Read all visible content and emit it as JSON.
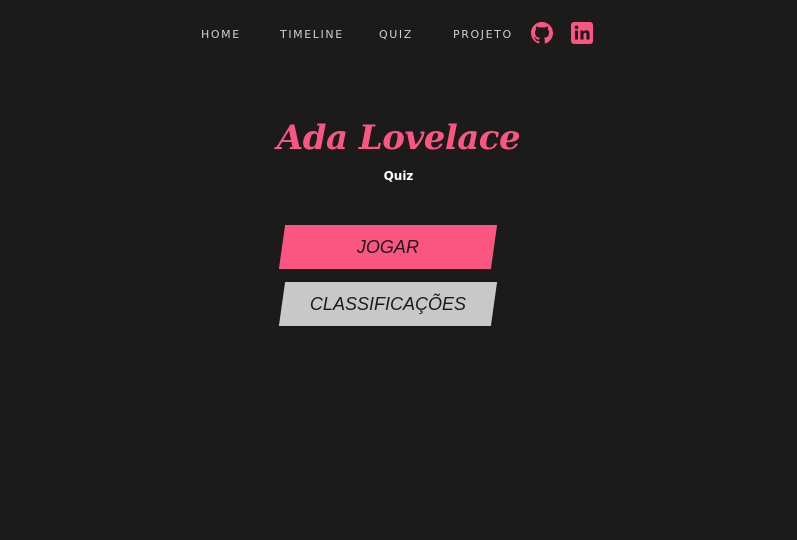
{
  "nav": {
    "links": [
      "HOME",
      "TIMELINE",
      "QUIZ",
      "PROJETO"
    ],
    "icons": [
      "github-icon",
      "linkedin-icon"
    ]
  },
  "main": {
    "title": "Ada Lovelace",
    "subtitle": "Quiz",
    "buttons": {
      "play": "JOGAR",
      "rankings": "CLASSIFICAÇÕES"
    }
  },
  "colors": {
    "background": "#1b1b1b",
    "accent": "#fb5581",
    "secondary_button": "#c8c8c8",
    "nav_text": "#cfcfcf"
  }
}
